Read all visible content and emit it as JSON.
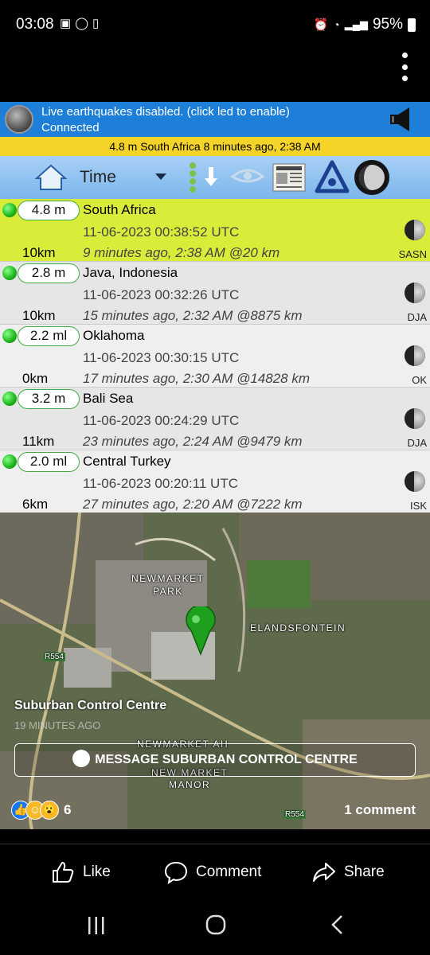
{
  "status_bar": {
    "time": "03:08",
    "battery": "95%"
  },
  "app": {
    "info_line1": "Live earthquakes disabled. (click led to enable)",
    "info_line2": "Connected",
    "latest_banner": "4.8 m South Africa 8 minutes ago, 2:38 AM",
    "sort_label": "Time"
  },
  "quakes": [
    {
      "mag": "4.8 m",
      "place": "South Africa",
      "utc": "11-06-2023 00:38:52 UTC",
      "ago": "9 minutes ago, 2:38 AM @20 km",
      "depth": "10km",
      "network": "SASN",
      "bg": "#d9ec3a"
    },
    {
      "mag": "2.8 m",
      "place": "Java, Indonesia",
      "utc": "11-06-2023 00:32:26 UTC",
      "ago": "15 minutes ago, 2:32 AM @8875 km",
      "depth": "10km",
      "network": "DJA",
      "bg": "#e6e6e6"
    },
    {
      "mag": "2.2 ml",
      "place": "Oklahoma",
      "utc": "11-06-2023 00:30:15 UTC",
      "ago": "17 minutes ago, 2:30 AM @14828 km",
      "depth": "0km",
      "network": "OK",
      "bg": "#efefef"
    },
    {
      "mag": "3.2 m",
      "place": "Bali Sea",
      "utc": "11-06-2023 00:24:29 UTC",
      "ago": "23 minutes ago, 2:24 AM @9479 km",
      "depth": "11km",
      "network": "DJA",
      "bg": "#e6e6e6"
    },
    {
      "mag": "2.0 ml",
      "place": "Central Turkey",
      "utc": "11-06-2023 00:20:11 UTC",
      "ago": "27 minutes ago, 2:20 AM @7222 km",
      "depth": "6km",
      "network": "ISK",
      "bg": "#efefef"
    }
  ],
  "map": {
    "labels": [
      "NEWMARKET\nPARK",
      "ELANDSFONTEIN",
      "R554",
      "NEWMARKET AH",
      "NEW MARKET\nMANOR",
      "R554"
    ]
  },
  "post": {
    "title": "Suburban Control Centre",
    "time": "19 MINUTES AGO",
    "message_button": "MESSAGE SUBURBAN CONTROL CENTRE",
    "reactions_count": "6",
    "comments": "1 comment"
  },
  "actions": {
    "like": "Like",
    "comment": "Comment",
    "share": "Share"
  }
}
